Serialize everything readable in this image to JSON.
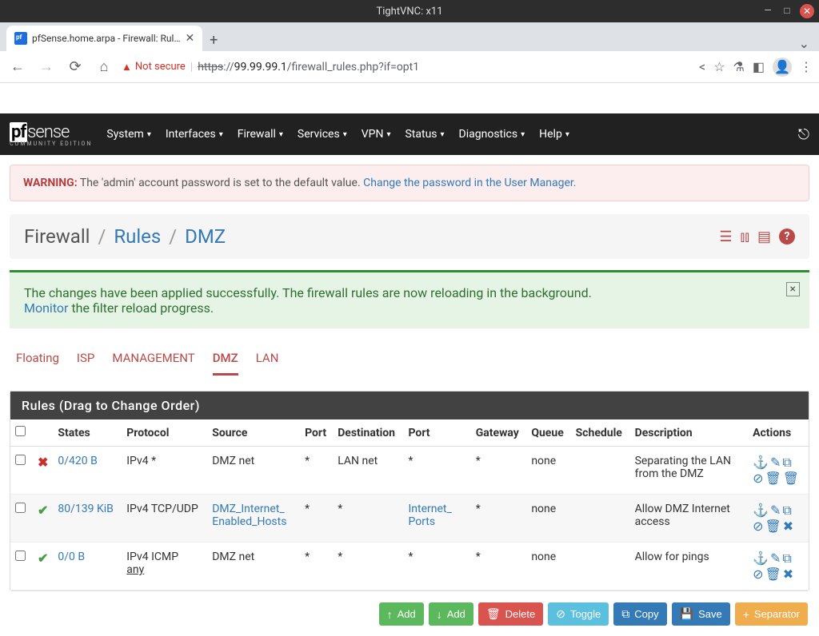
{
  "window": {
    "title": "TightVNC: x11"
  },
  "browser": {
    "tab_title": "pfSense.home.arpa - Firewall: Rul…",
    "insecure_label": "Not secure",
    "url_https": "https",
    "url_sep": "://",
    "url_host": "99.99.99.1",
    "url_path": "/firewall_rules.php?if=opt1"
  },
  "nav": {
    "logo_main_pf": "pf",
    "logo_main_rest": "sense",
    "logo_sub": "COMMUNITY EDITION",
    "menu": [
      "System",
      "Interfaces",
      "Firewall",
      "Services",
      "VPN",
      "Status",
      "Diagnostics",
      "Help"
    ]
  },
  "warning": {
    "label": "WARNING:",
    "text": " The 'admin' account password is set to the default value. ",
    "link": "Change the password in the User Manager."
  },
  "breadcrumb": {
    "a": "Firewall",
    "b": "Rules",
    "c": "DMZ"
  },
  "success": {
    "line1": "The changes have been applied successfully. The firewall rules are now reloading in the background.",
    "monitor": "Monitor",
    "line2_rest": " the filter reload progress."
  },
  "tabs": [
    "Floating",
    "ISP",
    "MANAGEMENT",
    "DMZ",
    "LAN"
  ],
  "active_tab": "DMZ",
  "panel_title": "Rules (Drag to Change Order)",
  "columns": [
    "",
    "",
    "States",
    "Protocol",
    "Source",
    "Port",
    "Destination",
    "Port",
    "Gateway",
    "Queue",
    "Schedule",
    "Description",
    "Actions"
  ],
  "rows": [
    {
      "status": "block",
      "states": "0/420 B",
      "protocol": "IPv4 *",
      "source": "DMZ net",
      "source_link": false,
      "sport": "*",
      "dest": "LAN net",
      "dest_link": false,
      "dport": "*",
      "dport_link": false,
      "gateway": "*",
      "queue": "none",
      "schedule": "",
      "description": "Separating the LAN from the DMZ",
      "del_icon": "trash"
    },
    {
      "status": "pass",
      "states": "80/139 KiB",
      "protocol": "IPv4 TCP/UDP",
      "source": "DMZ_Internet_Enabled_Hosts",
      "source_link": true,
      "sport": "*",
      "dest": "*",
      "dest_link": false,
      "dport": "Internet_Ports",
      "dport_link": true,
      "gateway": "*",
      "queue": "none",
      "schedule": "",
      "description": "Allow DMZ Internet access",
      "del_icon": "x"
    },
    {
      "status": "pass",
      "states": "0/0 B",
      "protocol": "IPv4 ICMP",
      "protocol_sub": "any",
      "source": "DMZ net",
      "source_link": false,
      "sport": "*",
      "dest": "*",
      "dest_link": false,
      "dport": "*",
      "dport_link": false,
      "gateway": "*",
      "queue": "none",
      "schedule": "",
      "description": "Allow for pings",
      "del_icon": "x"
    }
  ],
  "buttons": {
    "add1": "Add",
    "add2": "Add",
    "delete": "Delete",
    "toggle": "Toggle",
    "copy": "Copy",
    "save": "Save",
    "separator": "Separator"
  }
}
